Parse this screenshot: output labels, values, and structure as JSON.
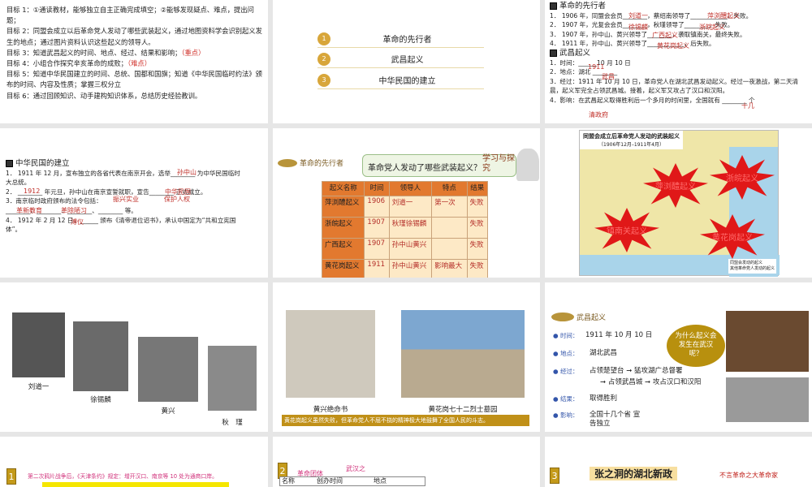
{
  "slide1": {
    "goals": [
      "目标 1：①通读教材，能够独立自主正确完成填空；②能够发现疑点、难点，提出问题；",
      "目标 2：同盟会成立以后革命党人发动了哪些武装起义，通过地图资料学会识别起义发生的地点；通过图片资料认识这些起义的领导人。",
      "目标 3：知道武昌起义的时间、地点、经过、结果和影响；",
      "目标 4：小组合作探究辛亥革命的成败；",
      "目标 5：知道中华民国建立的时间、总统、国都和国旗；知道《中华民国临时约法》颁布的时间、内容及性质；掌握三权分立",
      "目标 6：通过回顾知识、动手建构知识体系，总结历史经验教训。"
    ],
    "key": "（重点）",
    "difficult": "（难点）"
  },
  "slide2": {
    "items": [
      {
        "n": "1",
        "label": "革命的先行者"
      },
      {
        "n": "2",
        "label": "武昌起义"
      },
      {
        "n": "3",
        "label": "中华民国的建立"
      }
    ]
  },
  "slide3": {
    "h1": "革命的先行者",
    "l1": "1． 1906 年，同盟会会员________，蔡绍南领导了____________，失败。",
    "l2": "2． 1907 年，光复会会员________，秋瑾领导了________，失败。",
    "l3": "3． 1907 年，孙中山、黄兴领导了________，袭取镇南关，最终失败。",
    "l4": "4． 1911 年，孙中山、黄兴领导了____________，后失败。",
    "h2": "武昌起义",
    "w1": "1．时间：______10 月 10 日",
    "w2": "2．地点：湖北 ________",
    "w3": "3．经过：1911 年 10 月 10 日，革命党人在湖北武昌发动起义。经过一夜激战，第二天清晨，起义军完全占领武昌城。接着，起义军又攻占了汉口和汉阳。",
    "w4": "4．影响：在武昌起义取得胜利后一个多月的时间里，全国就有 ________ 个",
    "f": [
      "刘道一",
      "萍浏醴起义",
      "徐锡麟",
      "浙皖起义",
      "广西起义",
      "黄花岗起义",
      "1911",
      "武昌",
      "十几",
      "清政府"
    ]
  },
  "slide4": {
    "h": "中华民国的建立",
    "l1": "1． 1911 年 12 月，宣布独立的各省代表在南京开会，选举________ 为中华民国临时大总统。",
    "l2": "2． ________ 年元旦，孙中山在南京宣誓就职，宣告________ 正式成立。",
    "l3": "3．南京临时政府颁布的法令包括：",
    "l3b": "________、________、________、________ 等。",
    "l4": "4． 1912 年 2 月 12 日，______ 颁布《清帝退位诏书》，承认中国定为“共和立宪国体”。",
    "f": [
      "孙中山",
      "1912",
      "中华民国",
      "振兴实业",
      "保护人权",
      "革新教育",
      "革除陋习",
      "溥仪"
    ]
  },
  "slide5": {
    "h": "革命的先行者",
    "q": "革命党人发动了哪些武装起义？",
    "tag": "学习与探究",
    "head": [
      "起义名称",
      "时间",
      "领导人",
      "特点",
      "结果"
    ],
    "rows": [
      [
        "萍浏醴起义",
        "1906",
        "刘道一",
        "第一次",
        "失败"
      ],
      [
        "浙皖起义",
        "1907",
        "秋瑾徐锡麟",
        "",
        "失败"
      ],
      [
        "广西起义",
        "1907",
        "孙中山黄兴",
        "",
        "失败"
      ],
      [
        "黄花岗起义",
        "1911",
        "孙中山黄兴",
        "影响最大",
        "失败"
      ]
    ]
  },
  "slide6": {
    "title": "同盟会成立后革命党人发动的武装起义",
    "sub": "（1906年12月–1911年4月）",
    "stars": [
      "萍浏醴起义",
      "浙皖起义",
      "镇南关起义",
      "黄花岗起义"
    ],
    "legend": [
      "同盟会发动的起义",
      "其他革命党人发动的起义"
    ]
  },
  "slide7": {
    "people": [
      "刘道一",
      "徐锡麟",
      "黄兴",
      "秋　瑾"
    ]
  },
  "slide8": {
    "c1": "黄兴绝命书",
    "c2": "黄花岗七十二烈士墓园",
    "banner": "黄花岗起义虽然失败，但革命党人不屈不挠的精神极大地鼓舞了全国人民的斗志。"
  },
  "slide9": {
    "h": "武昌起义",
    "rows": [
      {
        "k": "时间：",
        "v": "1911 年 10 月 10 日"
      },
      {
        "k": "地点：",
        "v": "湖北武昌"
      },
      {
        "k": "经过：",
        "v": "占领楚望台 ➞ 猛攻湖广总督署"
      },
      {
        "k": "",
        "v": "➞ 占领武昌城 ➞ 攻占汉口和汉阳"
      },
      {
        "k": "结果：",
        "v": "取得胜利"
      },
      {
        "k": "影响：",
        "v": "全国十几个省 宣告独立"
      }
    ],
    "bubble": "为什么起义会发生在武汉呢？"
  },
  "slide10": {
    "n": "1",
    "text": "第二次鸦片战争后，《天津条约》规定：增开汉口、南京等 10 处为通商口岸。"
  },
  "slide11": {
    "n": "2",
    "t1": "武汉之",
    "t2": "革命团体",
    "h": [
      "名称",
      "创办时间",
      "地点"
    ]
  },
  "slide12": {
    "n": "3",
    "title": "张之洞的湖北新政",
    "side": "不言革命之大革命家"
  }
}
